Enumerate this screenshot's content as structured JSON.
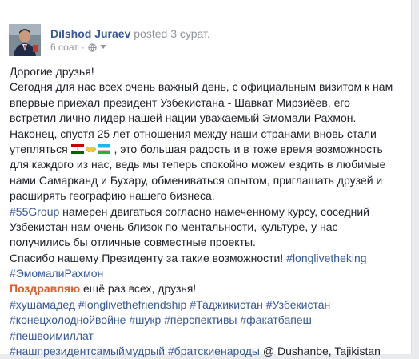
{
  "post": {
    "author": "Dilshod Juraev",
    "action": "posted 3 сурат.",
    "time": "6 соат",
    "separator": "·"
  },
  "icons": {
    "avatar": "profile-photo",
    "privacy": "globe-icon",
    "audience_dropdown": "caret-down-icon",
    "emoji_handshake": "handshake-icon"
  },
  "colors": {
    "link": "#365899",
    "text": "#1d2129",
    "meta": "#90949c",
    "highlight": "#e55a2b"
  },
  "body": {
    "l1": "Дорогие друзья!",
    "l2": "Сегодня для нас всех очень важный день, с официальным визитом к нам",
    "l3": "впервые приехал президент Узбекистана - Шавкат Мирзиёев, его",
    "l4": "встретил лично лидер нашей нации уважаемый Эмомали Рахмон.",
    "l5": "Наконец, спустя 25 лет отношения между наши странами вновь стали",
    "l6a": "утепляться ",
    "l6b": " , это большая радость и в тоже время возможность",
    "l7": "для каждого из нас, ведь мы теперь спокойно можем ездить в любимые",
    "l8": "нами Самарканд и Бухару, обмениваться опытом, приглашать друзей и",
    "l9": "расширять географию нашего бизнеса.",
    "l10_tag": "#55Group",
    "l10_text": " намерен двигаться согласно намеченному курсу, соседний",
    "l11": "Узбекистан нам очень близок по ментальности, культуре, у нас",
    "l12": "получились бы отличные совместные проекты.",
    "l13_text": "Спасибо нашему Президенту за такие возможности! ",
    "l13_tag": "#longlivetheking",
    "l14": "#ЭмомалиРахмон",
    "l15_red": "Поздравляю",
    "l15_text": " ещё раз всех, друзья!",
    "l16": "#хушамадед #longlivethefriendship #Таджикистан #Узбекистан",
    "l17": "#конецхолоднойвойне #шукр #перспективы #факатбапеш",
    "l18": "#пешвоимиллат",
    "l19_tags": "#нашпрезидентсамыймудрый #братскиенароды",
    "l19_text": " @ Dushanbe, Tajikistan"
  }
}
